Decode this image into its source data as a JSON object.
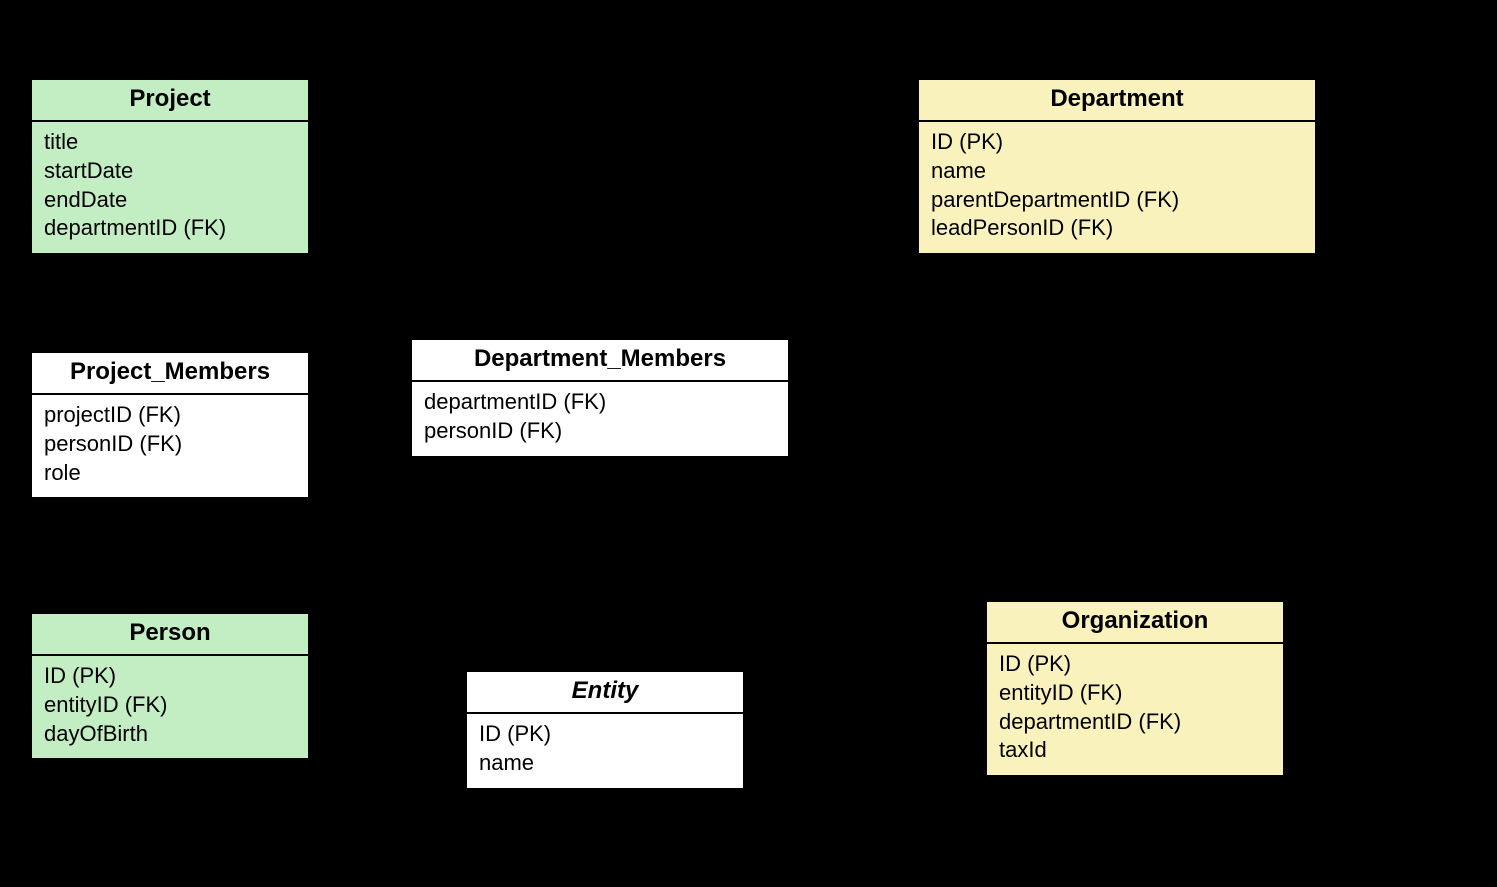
{
  "entities": {
    "project": {
      "name": "Project",
      "attrs": [
        "title",
        "startDate",
        "endDate",
        "departmentID (FK)"
      ]
    },
    "department": {
      "name": "Department",
      "attrs": [
        "ID (PK)",
        "name",
        "parentDepartmentID (FK)",
        "leadPersonID (FK)"
      ]
    },
    "project_members": {
      "name": "Project_Members",
      "attrs": [
        "projectID (FK)",
        "personID (FK)",
        "role"
      ]
    },
    "department_members": {
      "name": "Department_Members",
      "attrs": [
        "departmentID (FK)",
        "personID (FK)"
      ]
    },
    "person": {
      "name": "Person",
      "attrs": [
        "ID (PK)",
        "entityID (FK)",
        "dayOfBirth"
      ]
    },
    "entity": {
      "name": "Entity",
      "attrs": [
        "ID (PK)",
        "name"
      ]
    },
    "organization": {
      "name": "Organization",
      "attrs": [
        "ID (PK)",
        "entityID (FK)",
        "departmentID (FK)",
        "taxId"
      ]
    }
  }
}
